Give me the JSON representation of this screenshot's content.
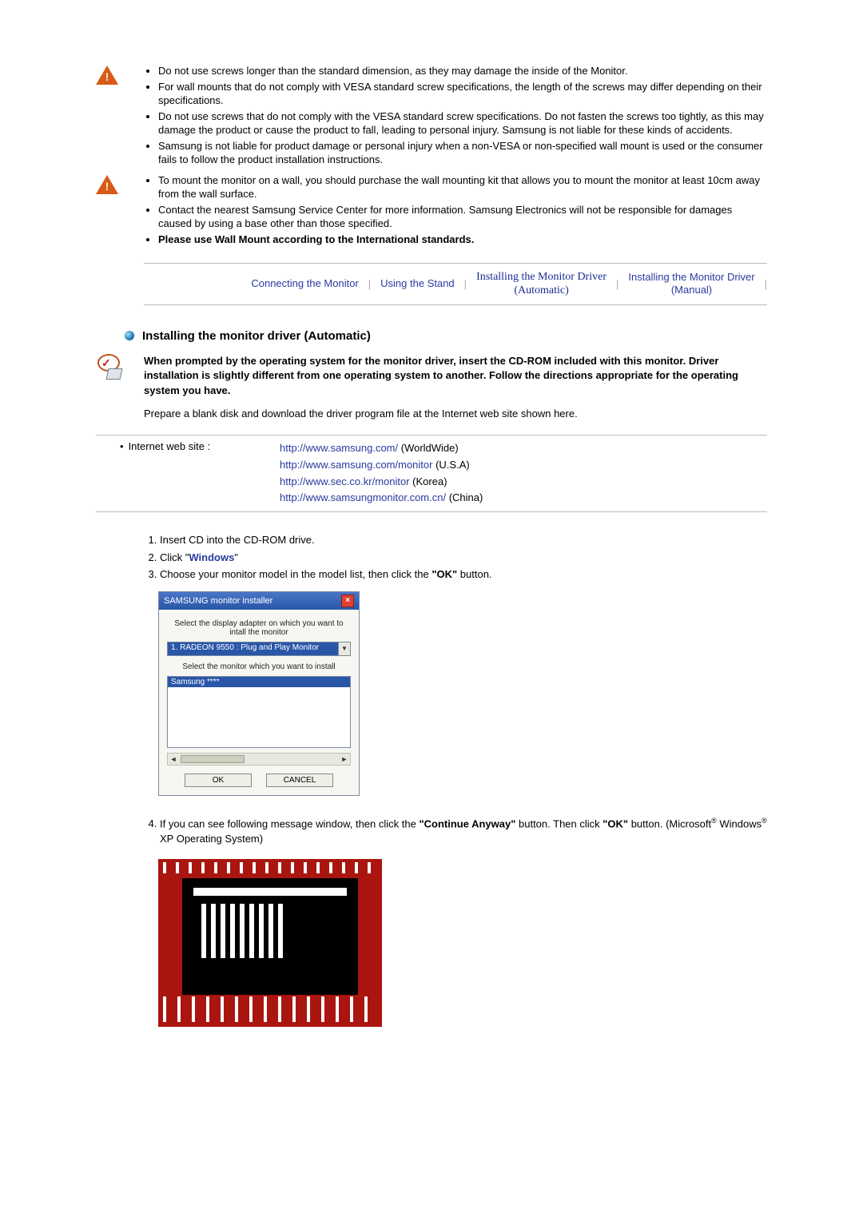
{
  "warnings1": [
    "Do not use screws longer than the standard dimension, as they may damage the inside of the Monitor.",
    "For wall mounts that do not comply with VESA standard screw specifications, the length of the screws may differ depending on their specifications.",
    "Do not use screws that do not comply with the VESA standard screw specifications. Do not fasten the screws too tightly, as this may damage the product or cause the product to fall, leading to personal injury. Samsung is not liable for these kinds of accidents.",
    "Samsung is not liable for product damage or personal injury when a non-VESA or non-specified wall mount is used or the consumer fails to follow the product installation instructions."
  ],
  "warnings2": [
    "To mount the monitor on a wall, you should purchase the wall mounting kit that allows you to mount the monitor at least 10cm away from the wall surface.",
    "Contact the nearest Samsung Service Center for more information. Samsung Electronics will not be responsible for damages caused by using a base other than those specified.",
    "Please use Wall Mount according to the International standards."
  ],
  "nav": {
    "connecting": "Connecting the Monitor",
    "stand": "Using the Stand",
    "auto_line1": "Installing the Monitor Driver",
    "auto_line2": "(Automatic)",
    "manual_line1": "Installing the Monitor Driver",
    "manual_line2": "(Manual)"
  },
  "section_title": "Installing the monitor driver (Automatic)",
  "intro_bold": "When prompted by the operating system for the monitor driver, insert the CD-ROM included with this monitor. Driver installation is slightly different from one operating system to another. Follow the directions appropriate for the operating system you have.",
  "intro_plain": "Prepare a blank disk and download the driver program file at the Internet web site shown here.",
  "links": {
    "label": "Internet web site :",
    "items": [
      {
        "url": "http://www.samsung.com/",
        "region": " (WorldWide)"
      },
      {
        "url": "http://www.samsung.com/monitor",
        "region": " (U.S.A)"
      },
      {
        "url": "http://www.sec.co.kr/monitor",
        "region": " (Korea)"
      },
      {
        "url": "http://www.samsungmonitor.com.cn/",
        "region": " (China)"
      }
    ]
  },
  "steps": {
    "s1": "Insert CD into the CD-ROM drive.",
    "s2_pre": "Click \"",
    "s2_kw": "Windows",
    "s2_post": "\"",
    "s3_pre": "Choose your monitor model in the model list, then click the ",
    "s3_bold": "\"OK\"",
    "s3_post": " button.",
    "s4_a": "If you can see following message window, then click the ",
    "s4_bold1": "\"Continue Anyway\"",
    "s4_b": " button. Then click ",
    "s4_bold2": "\"OK\"",
    "s4_c": " button. (Microsoft",
    "s4_d": " Windows",
    "s4_e": " XP Operating System)"
  },
  "installer": {
    "title": "SAMSUNG monitor installer",
    "label_adapter": "Select the display adapter on which you want to intall the monitor",
    "adapter": "1. RADEON 9550 : Plug and Play Monitor",
    "label_monitor": "Select the monitor which you want to install",
    "selected": "Samsung ****",
    "ok": "OK",
    "cancel": "CANCEL"
  }
}
